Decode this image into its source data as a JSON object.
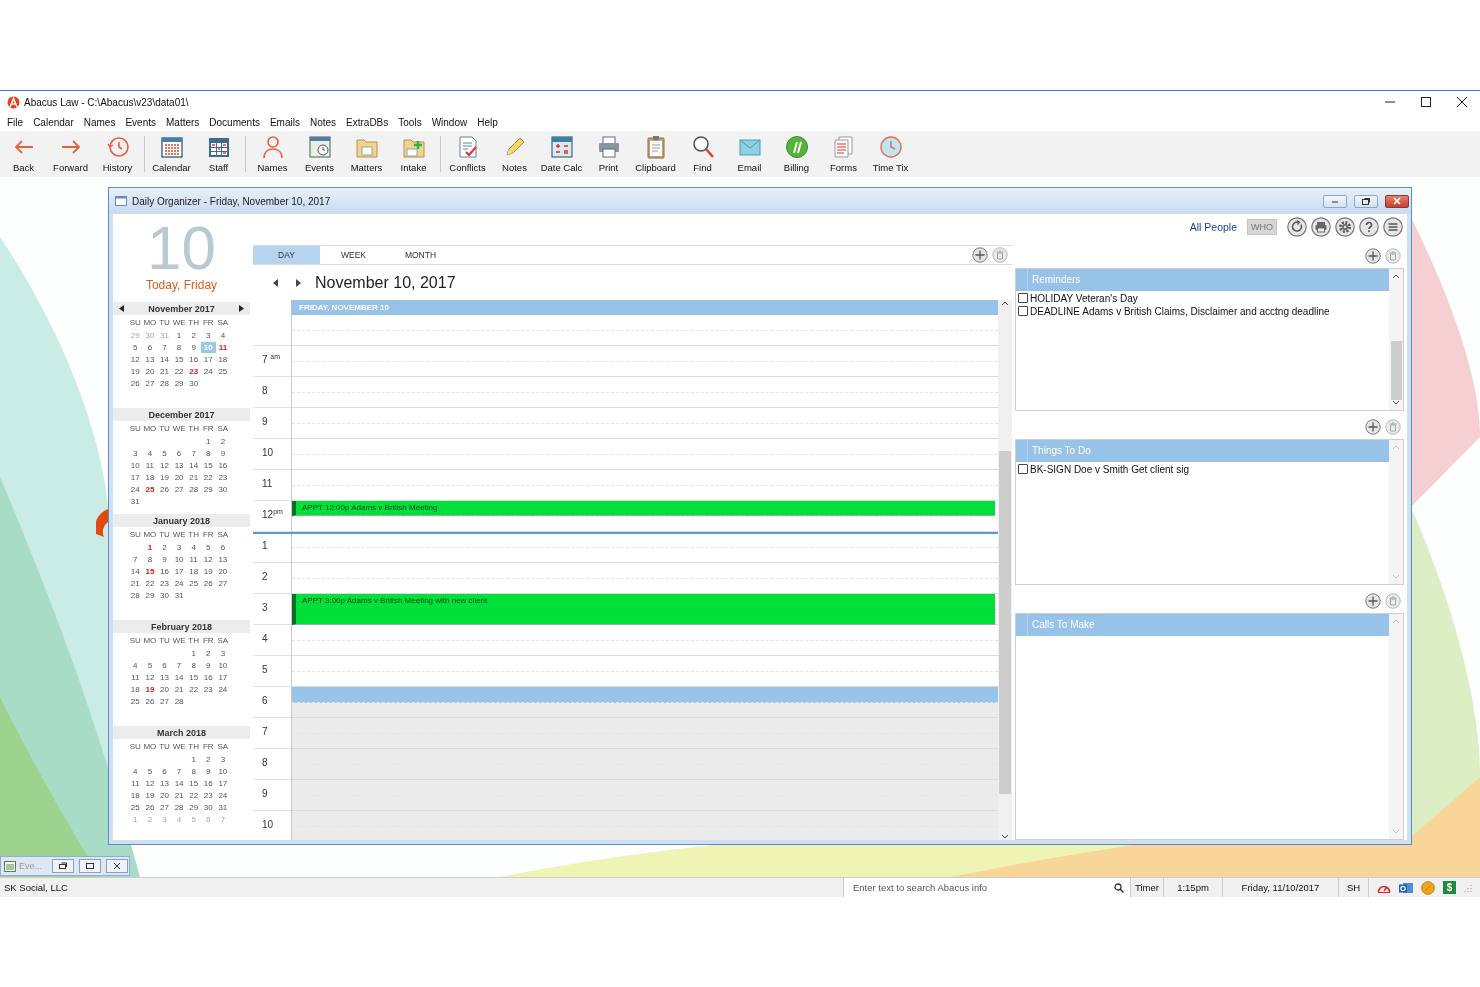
{
  "app": {
    "title": "Abacus Law  -  C:\\Abacus\\v23\\data01\\"
  },
  "menu": [
    "File",
    "Calendar",
    "Names",
    "Events",
    "Matters",
    "Documents",
    "Emails",
    "Notes",
    "ExtraDBs",
    "Tools",
    "Window",
    "Help"
  ],
  "toolbar": [
    [
      "Back",
      "Forward",
      "History"
    ],
    [
      "Calendar",
      "Staff"
    ],
    [
      "Names",
      "Events",
      "Matters",
      "Intake"
    ],
    [
      "Conflicts",
      "Notes",
      "Date Calc",
      "Print",
      "Clipboard",
      "Find",
      "Email",
      "Billing",
      "Forms",
      "Time Tix"
    ]
  ],
  "organizer": {
    "title": "Daily Organizer - Friday, November 10, 2017",
    "day_number": "10",
    "today": "Today, Friday",
    "months": [
      {
        "title": "November 2017",
        "weekdays": [
          "SU",
          "MO",
          "TU",
          "WE",
          "TH",
          "FR",
          "SA"
        ],
        "weeks": [
          [
            {
              "day": "29",
              "kind": "other",
              "selected": false
            },
            {
              "day": "30",
              "kind": "other",
              "selected": false
            },
            {
              "day": "31",
              "kind": "other",
              "selected": false
            },
            {
              "day": "1",
              "kind": "day",
              "selected": false
            },
            {
              "day": "2",
              "kind": "day",
              "selected": false
            },
            {
              "day": "3",
              "kind": "day",
              "selected": false
            },
            {
              "day": "4",
              "kind": "day",
              "selected": false
            }
          ],
          [
            {
              "day": "5",
              "kind": "day",
              "selected": false
            },
            {
              "day": "6",
              "kind": "day",
              "selected": false
            },
            {
              "day": "7",
              "kind": "day",
              "selected": false
            },
            {
              "day": "8",
              "kind": "day",
              "selected": false
            },
            {
              "day": "9",
              "kind": "day",
              "selected": false
            },
            {
              "day": "10",
              "kind": "day",
              "selected": true
            },
            {
              "day": "11",
              "kind": "holiday",
              "selected": false
            }
          ],
          [
            {
              "day": "12",
              "kind": "day",
              "selected": false
            },
            {
              "day": "13",
              "kind": "day",
              "selected": false
            },
            {
              "day": "14",
              "kind": "day",
              "selected": false
            },
            {
              "day": "15",
              "kind": "day",
              "selected": false
            },
            {
              "day": "16",
              "kind": "day",
              "selected": false
            },
            {
              "day": "17",
              "kind": "day",
              "selected": false
            },
            {
              "day": "18",
              "kind": "day",
              "selected": false
            }
          ],
          [
            {
              "day": "19",
              "kind": "day",
              "selected": false
            },
            {
              "day": "20",
              "kind": "day",
              "selected": false
            },
            {
              "day": "21",
              "kind": "day",
              "selected": false
            },
            {
              "day": "22",
              "kind": "day",
              "selected": false
            },
            {
              "day": "23",
              "kind": "holiday",
              "selected": false
            },
            {
              "day": "24",
              "kind": "day",
              "selected": false
            },
            {
              "day": "25",
              "kind": "day",
              "selected": false
            }
          ],
          [
            {
              "day": "26",
              "kind": "day",
              "selected": false
            },
            {
              "day": "27",
              "kind": "day",
              "selected": false
            },
            {
              "day": "28",
              "kind": "day",
              "selected": false
            },
            {
              "day": "29",
              "kind": "day",
              "selected": false
            },
            {
              "day": "30",
              "kind": "day",
              "selected": false
            }
          ]
        ]
      },
      {
        "title": "December 2017",
        "weekdays": [
          "SU",
          "MO",
          "TU",
          "WE",
          "TH",
          "FR",
          "SA"
        ],
        "weeks": [
          [
            {
              "day": "1",
              "kind": "day",
              "selected": false
            },
            {
              "day": "2",
              "kind": "day",
              "selected": false
            }
          ],
          [
            {
              "day": "3",
              "kind": "day",
              "selected": false
            },
            {
              "day": "4",
              "kind": "day",
              "selected": false
            },
            {
              "day": "5",
              "kind": "day",
              "selected": false
            },
            {
              "day": "6",
              "kind": "day",
              "selected": false
            },
            {
              "day": "7",
              "kind": "day",
              "selected": false
            },
            {
              "day": "8",
              "kind": "day",
              "selected": false
            },
            {
              "day": "9",
              "kind": "day",
              "selected": false
            }
          ],
          [
            {
              "day": "10",
              "kind": "day",
              "selected": false
            },
            {
              "day": "11",
              "kind": "day",
              "selected": false
            },
            {
              "day": "12",
              "kind": "day",
              "selected": false
            },
            {
              "day": "13",
              "kind": "day",
              "selected": false
            },
            {
              "day": "14",
              "kind": "day",
              "selected": false
            },
            {
              "day": "15",
              "kind": "day",
              "selected": false
            },
            {
              "day": "16",
              "kind": "day",
              "selected": false
            }
          ],
          [
            {
              "day": "17",
              "kind": "day",
              "selected": false
            },
            {
              "day": "18",
              "kind": "day",
              "selected": false
            },
            {
              "day": "19",
              "kind": "day",
              "selected": false
            },
            {
              "day": "20",
              "kind": "day",
              "selected": false
            },
            {
              "day": "21",
              "kind": "day",
              "selected": false
            },
            {
              "day": "22",
              "kind": "day",
              "selected": false
            },
            {
              "day": "23",
              "kind": "day",
              "selected": false
            }
          ],
          [
            {
              "day": "24",
              "kind": "day",
              "selected": false
            },
            {
              "day": "25",
              "kind": "holiday",
              "selected": false
            },
            {
              "day": "26",
              "kind": "day",
              "selected": false
            },
            {
              "day": "27",
              "kind": "day",
              "selected": false
            },
            {
              "day": "28",
              "kind": "day",
              "selected": false
            },
            {
              "day": "29",
              "kind": "day",
              "selected": false
            },
            {
              "day": "30",
              "kind": "day",
              "selected": false
            }
          ],
          [
            {
              "day": "31",
              "kind": "day",
              "selected": false
            }
          ]
        ]
      },
      {
        "title": "January 2018",
        "weekdays": [
          "SU",
          "MO",
          "TU",
          "WE",
          "TH",
          "FR",
          "SA"
        ],
        "weeks": [
          [
            {
              "day": "1",
              "kind": "holiday",
              "selected": false
            },
            {
              "day": "2",
              "kind": "day",
              "selected": false
            },
            {
              "day": "3",
              "kind": "day",
              "selected": false
            },
            {
              "day": "4",
              "kind": "day",
              "selected": false
            },
            {
              "day": "5",
              "kind": "day",
              "selected": false
            },
            {
              "day": "6",
              "kind": "day",
              "selected": false
            }
          ],
          [
            {
              "day": "7",
              "kind": "day",
              "selected": false
            },
            {
              "day": "8",
              "kind": "day",
              "selected": false
            },
            {
              "day": "9",
              "kind": "day",
              "selected": false
            },
            {
              "day": "10",
              "kind": "day",
              "selected": false
            },
            {
              "day": "11",
              "kind": "day",
              "selected": false
            },
            {
              "day": "12",
              "kind": "day",
              "selected": false
            },
            {
              "day": "13",
              "kind": "day",
              "selected": false
            }
          ],
          [
            {
              "day": "14",
              "kind": "day",
              "selected": false
            },
            {
              "day": "15",
              "kind": "holiday",
              "selected": false
            },
            {
              "day": "16",
              "kind": "day",
              "selected": false
            },
            {
              "day": "17",
              "kind": "day",
              "selected": false
            },
            {
              "day": "18",
              "kind": "day",
              "selected": false
            },
            {
              "day": "19",
              "kind": "day",
              "selected": false
            },
            {
              "day": "20",
              "kind": "day",
              "selected": false
            }
          ],
          [
            {
              "day": "21",
              "kind": "day",
              "selected": false
            },
            {
              "day": "22",
              "kind": "day",
              "selected": false
            },
            {
              "day": "23",
              "kind": "day",
              "selected": false
            },
            {
              "day": "24",
              "kind": "day",
              "selected": false
            },
            {
              "day": "25",
              "kind": "day",
              "selected": false
            },
            {
              "day": "26",
              "kind": "day",
              "selected": false
            },
            {
              "day": "27",
              "kind": "day",
              "selected": false
            }
          ],
          [
            {
              "day": "28",
              "kind": "day",
              "selected": false
            },
            {
              "day": "29",
              "kind": "day",
              "selected": false
            },
            {
              "day": "30",
              "kind": "day",
              "selected": false
            },
            {
              "day": "31",
              "kind": "day",
              "selected": false
            }
          ]
        ]
      },
      {
        "title": "February 2018",
        "weekdays": [
          "SU",
          "MO",
          "TU",
          "WE",
          "TH",
          "FR",
          "SA"
        ],
        "weeks": [
          [
            {
              "day": "1",
              "kind": "day",
              "selected": false
            },
            {
              "day": "2",
              "kind": "day",
              "selected": false
            },
            {
              "day": "3",
              "kind": "day",
              "selected": false
            }
          ],
          [
            {
              "day": "4",
              "kind": "day",
              "selected": false
            },
            {
              "day": "5",
              "kind": "day",
              "selected": false
            },
            {
              "day": "6",
              "kind": "day",
              "selected": false
            },
            {
              "day": "7",
              "kind": "day",
              "selected": false
            },
            {
              "day": "8",
              "kind": "day",
              "selected": false
            },
            {
              "day": "9",
              "kind": "day",
              "selected": false
            },
            {
              "day": "10",
              "kind": "day",
              "selected": false
            }
          ],
          [
            {
              "day": "11",
              "kind": "day",
              "selected": false
            },
            {
              "day": "12",
              "kind": "day",
              "selected": false
            },
            {
              "day": "13",
              "kind": "day",
              "selected": false
            },
            {
              "day": "14",
              "kind": "day",
              "selected": false
            },
            {
              "day": "15",
              "kind": "day",
              "selected": false
            },
            {
              "day": "16",
              "kind": "day",
              "selected": false
            },
            {
              "day": "17",
              "kind": "day",
              "selected": false
            }
          ],
          [
            {
              "day": "18",
              "kind": "day",
              "selected": false
            },
            {
              "day": "19",
              "kind": "holiday",
              "selected": false
            },
            {
              "day": "20",
              "kind": "day",
              "selected": false
            },
            {
              "day": "21",
              "kind": "day",
              "selected": false
            },
            {
              "day": "22",
              "kind": "day",
              "selected": false
            },
            {
              "day": "23",
              "kind": "day",
              "selected": false
            },
            {
              "day": "24",
              "kind": "day",
              "selected": false
            }
          ],
          [
            {
              "day": "25",
              "kind": "day",
              "selected": false
            },
            {
              "day": "26",
              "kind": "day",
              "selected": false
            },
            {
              "day": "27",
              "kind": "day",
              "selected": false
            },
            {
              "day": "28",
              "kind": "day",
              "selected": false
            }
          ]
        ]
      },
      {
        "title": "March 2018",
        "weekdays": [
          "SU",
          "MO",
          "TU",
          "WE",
          "TH",
          "FR",
          "SA"
        ],
        "weeks": [
          [
            {
              "day": "1",
              "kind": "day",
              "selected": false
            },
            {
              "day": "2",
              "kind": "day",
              "selected": false
            },
            {
              "day": "3",
              "kind": "day",
              "selected": false
            }
          ],
          [
            {
              "day": "4",
              "kind": "day",
              "selected": false
            },
            {
              "day": "5",
              "kind": "day",
              "selected": false
            },
            {
              "day": "6",
              "kind": "day",
              "selected": false
            },
            {
              "day": "7",
              "kind": "day",
              "selected": false
            },
            {
              "day": "8",
              "kind": "day",
              "selected": false
            },
            {
              "day": "9",
              "kind": "day",
              "selected": false
            },
            {
              "day": "10",
              "kind": "day",
              "selected": false
            }
          ],
          [
            {
              "day": "11",
              "kind": "day",
              "selected": false
            },
            {
              "day": "12",
              "kind": "day",
              "selected": false
            },
            {
              "day": "13",
              "kind": "day",
              "selected": false
            },
            {
              "day": "14",
              "kind": "day",
              "selected": false
            },
            {
              "day": "15",
              "kind": "day",
              "selected": false
            },
            {
              "day": "16",
              "kind": "day",
              "selected": false
            },
            {
              "day": "17",
              "kind": "day",
              "selected": false
            }
          ],
          [
            {
              "day": "18",
              "kind": "day",
              "selected": false
            },
            {
              "day": "19",
              "kind": "day",
              "selected": false
            },
            {
              "day": "20",
              "kind": "day",
              "selected": false
            },
            {
              "day": "21",
              "kind": "day",
              "selected": false
            },
            {
              "day": "22",
              "kind": "day",
              "selected": false
            },
            {
              "day": "23",
              "kind": "day",
              "selected": false
            },
            {
              "day": "24",
              "kind": "day",
              "selected": false
            }
          ],
          [
            {
              "day": "25",
              "kind": "day",
              "selected": false
            },
            {
              "day": "26",
              "kind": "day",
              "selected": false
            },
            {
              "day": "27",
              "kind": "day",
              "selected": false
            },
            {
              "day": "28",
              "kind": "day",
              "selected": false
            },
            {
              "day": "29",
              "kind": "day",
              "selected": false
            },
            {
              "day": "30",
              "kind": "day",
              "selected": false
            },
            {
              "day": "31",
              "kind": "day",
              "selected": false
            }
          ],
          [
            {
              "day": "1",
              "kind": "other",
              "selected": false
            },
            {
              "day": "2",
              "kind": "other",
              "selected": false
            },
            {
              "day": "3",
              "kind": "other",
              "selected": false
            },
            {
              "day": "4",
              "kind": "other",
              "selected": false
            },
            {
              "day": "5",
              "kind": "other",
              "selected": false
            },
            {
              "day": "6",
              "kind": "other",
              "selected": false
            },
            {
              "day": "7",
              "kind": "other",
              "selected": false
            }
          ]
        ]
      }
    ],
    "day_view": {
      "tabs": [
        {
          "label": "DAY",
          "selected": true
        },
        {
          "label": "WEEK",
          "selected": false
        },
        {
          "label": "MONTH",
          "selected": false
        }
      ],
      "date": "November 10, 2017",
      "day_header": "FRIDAY, NOVEMBER 10",
      "hours": [
        {
          "label": "7 $^{am}$",
          "slots": [
            {
              "kind": "work"
            },
            {
              "kind": "work"
            }
          ],
          "now_line": false
        },
        {
          "label": "8",
          "slots": [
            {
              "kind": "work"
            },
            {
              "kind": "work"
            }
          ],
          "now_line": false
        },
        {
          "label": "9",
          "slots": [
            {
              "kind": "work"
            },
            {
              "kind": "work"
            }
          ],
          "now_line": false
        },
        {
          "label": "10",
          "slots": [
            {
              "kind": "work"
            },
            {
              "kind": "work"
            }
          ],
          "now_line": false
        },
        {
          "label": "11",
          "slots": [
            {
              "kind": "work"
            },
            {
              "kind": "work"
            }
          ],
          "now_line": false
        },
        {
          "label": "12$^{pm}$",
          "slots": [
            {
              "kind": "work"
            },
            {
              "kind": "work"
            }
          ],
          "now_line": false,
          "appointments": [
            {
              "text": "APPT 12:00p Adams v British Meeting",
              "kind": "half"
            }
          ]
        },
        {
          "label": "1",
          "slots": [
            {
              "kind": "work"
            },
            {
              "kind": "work"
            }
          ],
          "now_line": true
        },
        {
          "label": "2",
          "slots": [
            {
              "kind": "work"
            },
            {
              "kind": "work"
            }
          ],
          "now_line": false
        },
        {
          "label": "3",
          "slots": [
            {
              "kind": "work"
            },
            {
              "kind": "work"
            }
          ],
          "now_line": false,
          "appointments": [
            {
              "text": "APPT 3:00p Adams v British Meeting with new client",
              "kind": "hour"
            }
          ]
        },
        {
          "label": "4",
          "slots": [
            {
              "kind": "work"
            },
            {
              "kind": "work"
            }
          ],
          "now_line": false
        },
        {
          "label": "5",
          "slots": [
            {
              "kind": "work"
            },
            {
              "kind": "work"
            }
          ],
          "now_line": false
        },
        {
          "label": "6",
          "slots": [
            {
              "kind": "selected"
            },
            {
              "kind": "off"
            }
          ],
          "now_line": false
        },
        {
          "label": "7",
          "slots": [
            {
              "kind": "off"
            },
            {
              "kind": "off"
            }
          ],
          "now_line": false
        },
        {
          "label": "8",
          "slots": [
            {
              "kind": "off"
            },
            {
              "kind": "off"
            }
          ],
          "now_line": false
        },
        {
          "label": "9",
          "slots": [
            {
              "kind": "off"
            },
            {
              "kind": "off"
            }
          ],
          "now_line": false
        },
        {
          "label": "10",
          "slots": [
            {
              "kind": "off"
            },
            {
              "kind": "off"
            }
          ],
          "now_line": false
        }
      ]
    },
    "people_filter": "All People",
    "who_button": "WHO",
    "panels": [
      {
        "title": "Reminders",
        "scrollable": true,
        "items": [
          {
            "text": "HOLIDAY Veteran's Day",
            "checked": false
          },
          {
            "text": "DEADLINE Adams v British Claims, Disclaimer and acctng deadline",
            "checked": false
          }
        ]
      },
      {
        "title": "Things To Do",
        "scrollable": false,
        "items": [
          {
            "text": "BK-SIGN Doe v Smith Get client sig",
            "checked": false
          }
        ]
      },
      {
        "title": "Calls To Make",
        "scrollable": false
      }
    ]
  },
  "minimized_window": {
    "title": "Eve..."
  },
  "status_bar": {
    "company": "SK Social, LLC",
    "search": {
      "placeholder": "Enter text to search Abacus info"
    },
    "timer": "Timer",
    "time": "1:15pm",
    "date": "Friday, 11/10/2017",
    "user": "SH",
    "billing_symbol": "$"
  }
}
